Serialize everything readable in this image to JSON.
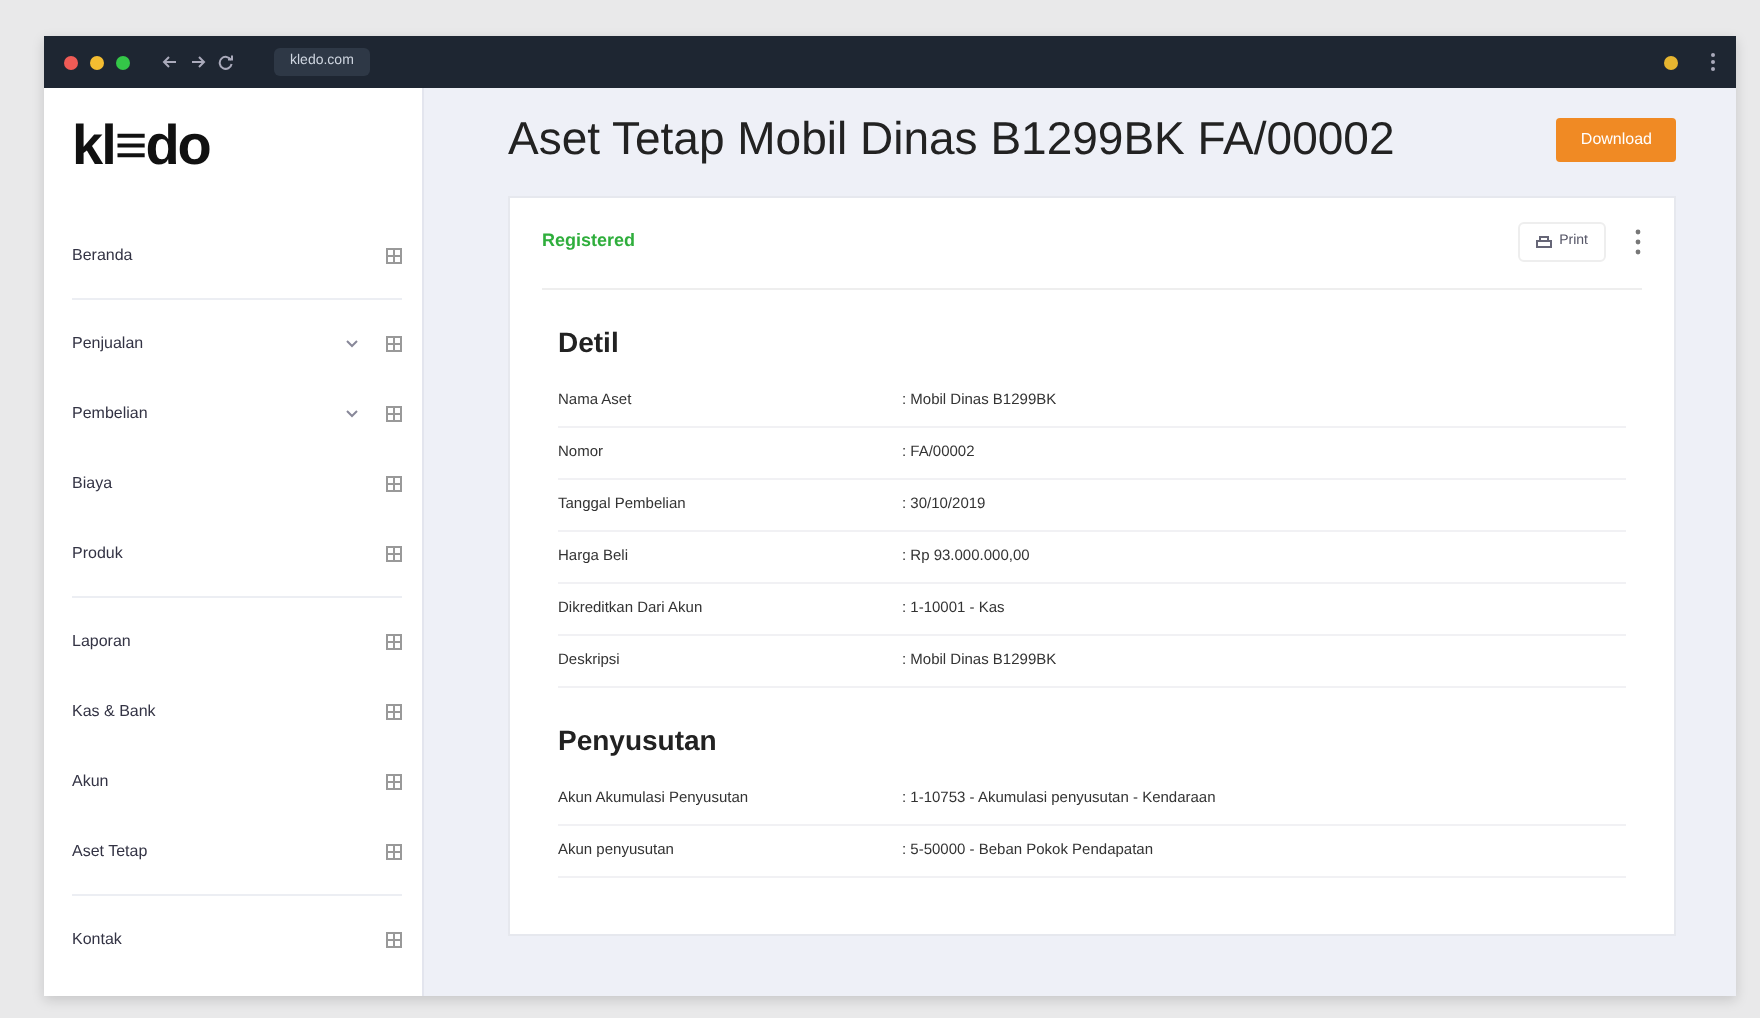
{
  "browser": {
    "address": "kledo.com"
  },
  "sidebar": {
    "logo": "kl≡do",
    "groups": [
      [
        {
          "label": "Beranda",
          "expandable": false
        }
      ],
      [
        {
          "label": "Penjualan",
          "expandable": true
        },
        {
          "label": "Pembelian",
          "expandable": true
        },
        {
          "label": "Biaya",
          "expandable": false
        },
        {
          "label": "Produk",
          "expandable": false
        }
      ],
      [
        {
          "label": "Laporan",
          "expandable": false
        },
        {
          "label": "Kas & Bank",
          "expandable": false
        },
        {
          "label": "Akun",
          "expandable": false
        },
        {
          "label": "Aset Tetap",
          "expandable": false
        }
      ],
      [
        {
          "label": "Kontak",
          "expandable": false
        }
      ]
    ]
  },
  "page": {
    "title": "Aset Tetap Mobil Dinas B1299BK FA/00002",
    "action_button": "Download"
  },
  "card": {
    "status": "Registered",
    "print_button": "Print",
    "sections": [
      {
        "heading": "Detil",
        "rows": [
          {
            "label": "Nama Aset",
            "value": ": Mobil Dinas B1299BK"
          },
          {
            "label": "Nomor",
            "value": ": FA/00002"
          },
          {
            "label": "Tanggal Pembelian",
            "value": ": 30/10/2019"
          },
          {
            "label": "Harga Beli",
            "value": ": Rp 93.000.000,00"
          },
          {
            "label": "Dikreditkan Dari Akun",
            "value": ": 1-10001 - Kas"
          },
          {
            "label": "Deskripsi",
            "value": ": Mobil Dinas B1299BK"
          }
        ]
      },
      {
        "heading": "Penyusutan",
        "rows": [
          {
            "label": "Akun Akumulasi Penyusutan",
            "value": ": 1-10753 - Akumulasi penyusutan - Kendaraan"
          },
          {
            "label": "Akun penyusutan",
            "value": ": 5-50000 - Beban Pokok Pendapatan"
          }
        ]
      }
    ]
  }
}
